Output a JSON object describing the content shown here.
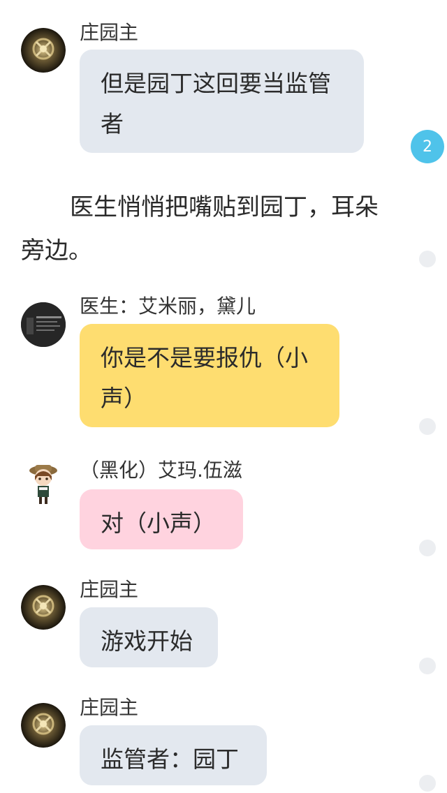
{
  "messages": [
    {
      "sender": "庄园主",
      "text": "但是园丁这回要当监管者"
    },
    {
      "narration": "医生悄悄把嘴贴到园丁，耳朵旁边。"
    },
    {
      "sender": "医生：艾米丽，黛儿",
      "text": "你是不是要报仇（小声）"
    },
    {
      "sender": "（黑化）艾玛.伍滋",
      "text": "对（小声）"
    },
    {
      "sender": "庄园主",
      "text": "游戏开始"
    },
    {
      "sender": "庄园主",
      "text": "监管者：园丁"
    }
  ],
  "unread_badge": "2",
  "colors": {
    "bubble_gray": "#e3e8ef",
    "bubble_yellow": "#fedd70",
    "bubble_pink": "#ffd3df",
    "badge": "#4fc3ea"
  },
  "icons": [
    "manor-owner-avatar",
    "doctor-avatar",
    "emma-chibi-avatar"
  ]
}
